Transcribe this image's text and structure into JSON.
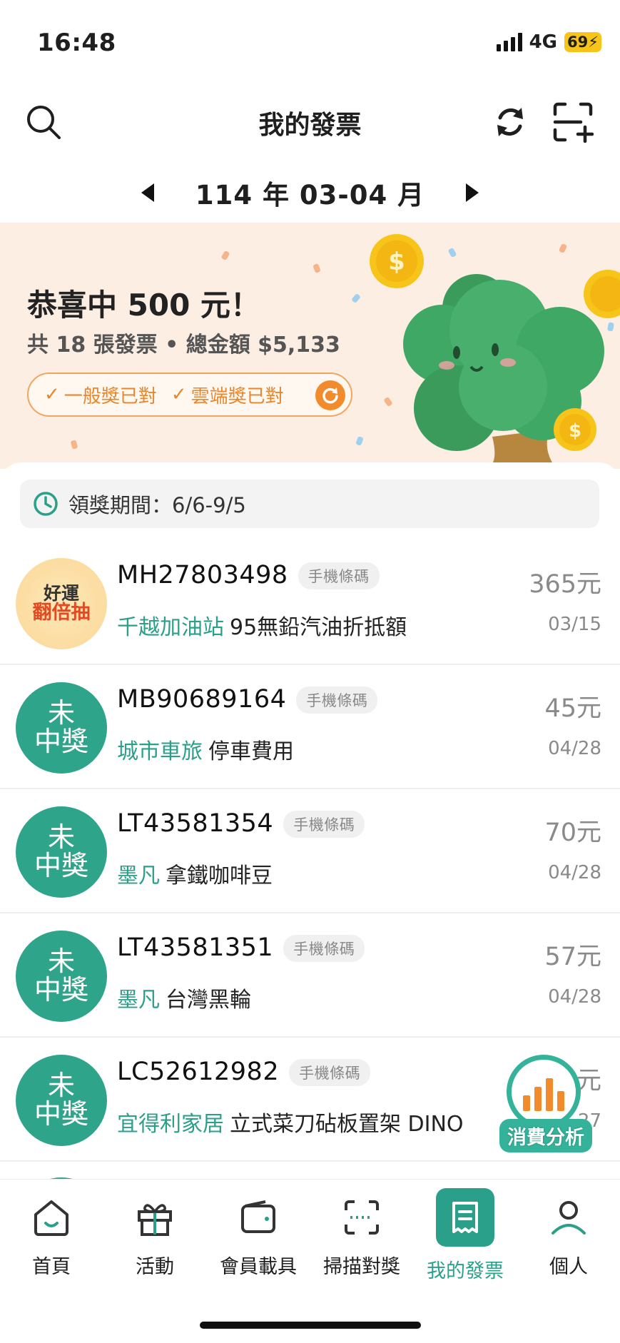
{
  "status_bar": {
    "time": "16:48",
    "network": "4G",
    "battery": "69"
  },
  "header": {
    "title": "我的發票"
  },
  "period": {
    "label": "114 年 03-04 月"
  },
  "banner": {
    "headline": "恭喜中 500 元！",
    "summary": "共 18 張發票 • 總金額 $5,133",
    "checks": [
      "一般獎已對",
      "雲端獎已對"
    ]
  },
  "claim_period": "領獎期間：6/6-9/5",
  "invoices": [
    {
      "avatar_type": "luck",
      "avatar_line1": "好運",
      "avatar_line2": "翻倍抽",
      "number": "MH27803498",
      "carrier": "手機條碼",
      "merchant": "千越加油站",
      "item": "95無鉛汽油折抵額",
      "amount": "365元",
      "date": "03/15"
    },
    {
      "avatar_type": "loss",
      "avatar_line1": "未",
      "avatar_line2": "中獎",
      "number": "MB90689164",
      "carrier": "手機條碼",
      "merchant": "城市車旅",
      "item": "停車費用",
      "amount": "45元",
      "date": "04/28"
    },
    {
      "avatar_type": "loss",
      "avatar_line1": "未",
      "avatar_line2": "中獎",
      "number": "LT43581354",
      "carrier": "手機條碼",
      "merchant": "墨凡",
      "item": "拿鐵咖啡豆",
      "amount": "70元",
      "date": "04/28"
    },
    {
      "avatar_type": "loss",
      "avatar_line1": "未",
      "avatar_line2": "中獎",
      "number": "LT43581351",
      "carrier": "手機條碼",
      "merchant": "墨凡",
      "item": "台灣黑輪",
      "amount": "57元",
      "date": "04/28"
    },
    {
      "avatar_type": "loss",
      "avatar_line1": "未",
      "avatar_line2": "中獎",
      "number": "LC52612982",
      "carrier": "手機條碼",
      "merchant": "宜得利家居",
      "item": "立式菜刀砧板置架 DINO",
      "amount": "1 6元",
      "date": "27"
    }
  ],
  "fab": {
    "label": "消費分析"
  },
  "tabs": [
    {
      "label": "首頁",
      "icon": "home-icon"
    },
    {
      "label": "活動",
      "icon": "gift-icon"
    },
    {
      "label": "會員載具",
      "icon": "wallet-icon"
    },
    {
      "label": "掃描對獎",
      "icon": "scan-icon"
    },
    {
      "label": "我的發票",
      "icon": "receipt-icon",
      "active": true
    },
    {
      "label": "個人",
      "icon": "person-icon"
    }
  ],
  "colors": {
    "accent": "#2aa08b",
    "orange": "#f28b2b",
    "banner_bg": "#fdeee3"
  }
}
